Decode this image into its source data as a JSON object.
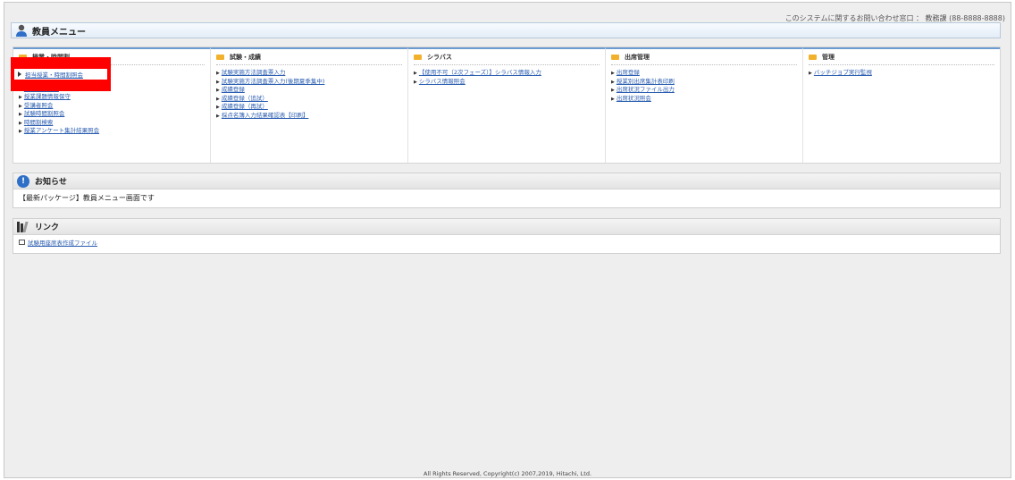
{
  "header": {
    "contact_text": "このシステムに関するお問い合わせ窓口 ： 教務課 (88-8888-8888)",
    "menu_title": "教員メニュー"
  },
  "panels": [
    {
      "title": "授業・時間割",
      "items": [
        "担当授業・時間割照会",
        "補講状況照会",
        "授業課題情報保守",
        "受講者照会",
        "試験時間割照会",
        "時間割検索",
        "授業アンケート集計結果照会"
      ]
    },
    {
      "title": "試験・成績",
      "items": [
        "試験実施方法調査票入力",
        "試験実施方法調査票入力(後期夏季集中)",
        "成績登録",
        "成績登録（追試）",
        "成績登録（再試）",
        "採点名簿入力結果確認表【印刷】"
      ]
    },
    {
      "title": "シラバス",
      "items": [
        "【使用不可（2次フェーズ）】シラバス情報入力",
        "シラバス情報照会"
      ]
    },
    {
      "title": "出席管理",
      "items": [
        "出席登録",
        "授業別出席集計表印刷",
        "出席状況ファイル出力",
        "出席状況照会"
      ]
    },
    {
      "title": "管理",
      "items": [
        "バッチジョブ実行監視"
      ]
    }
  ],
  "notice": {
    "title": "お知らせ",
    "text": "【最新パッケージ】教員メニュー画面です"
  },
  "links": {
    "title": "リンク",
    "items": [
      "試験用座席表作成ファイル"
    ]
  },
  "footer": "All Rights Reserved, Copyright(c) 2007,2019, Hitachi, Ltd."
}
